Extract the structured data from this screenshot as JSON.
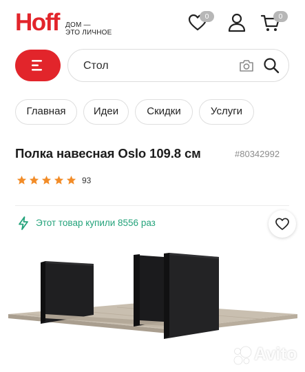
{
  "header": {
    "logo_text": "Hoff",
    "logo_tagline_line1": "ДОМ —",
    "logo_tagline_line2": "ЭТО ЛИЧНОЕ",
    "favorites_count": "0",
    "cart_count": "0",
    "icons": [
      "heart-icon",
      "user-icon",
      "cart-icon"
    ]
  },
  "search": {
    "value": "Стол",
    "icons": [
      "camera-icon",
      "search-icon"
    ]
  },
  "chips": [
    {
      "label": "Главная"
    },
    {
      "label": "Идеи"
    },
    {
      "label": "Скидки"
    },
    {
      "label": "Услуги"
    }
  ],
  "product": {
    "title": "Полка навесная Oslo 109.8 см",
    "article": "#80342992",
    "rating_stars": 5,
    "rating_count": "93",
    "bought_text": "Этот товар купили 8556 раз"
  },
  "watermark": {
    "text": "Avito"
  },
  "colors": {
    "brand_red": "#e2252b",
    "star": "#f28c28",
    "bought_green": "#24a37b",
    "badge_grey": "#b7b7b7"
  }
}
